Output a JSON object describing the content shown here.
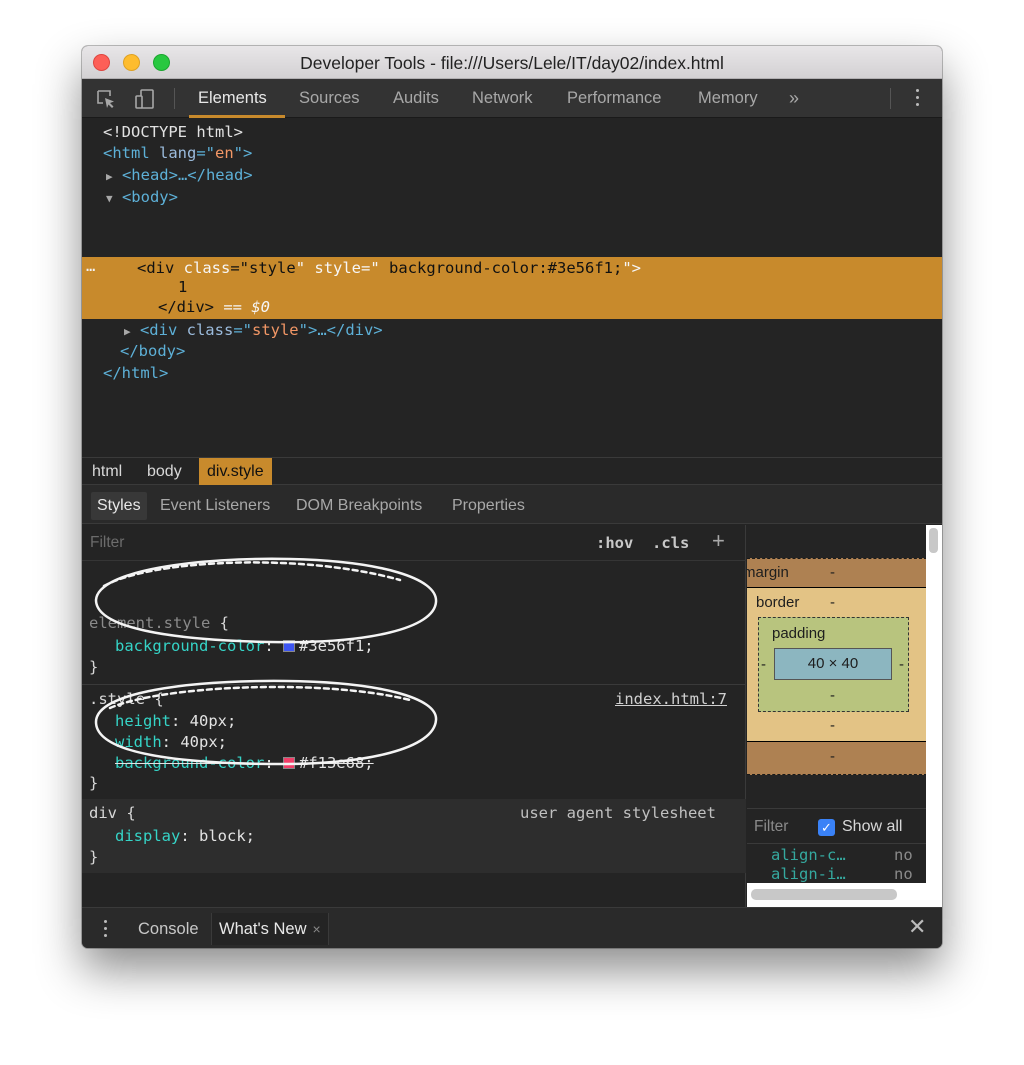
{
  "window": {
    "title": "Developer Tools - file:///Users/Lele/IT/day02/index.html"
  },
  "toolbar": {
    "tabs": [
      "Elements",
      "Sources",
      "Audits",
      "Network",
      "Performance",
      "Memory"
    ],
    "active_tab": "Elements",
    "overflow": "»",
    "icons": [
      "inspect-element-icon",
      "device-toolbar-icon",
      "more-menu-icon"
    ]
  },
  "dom": {
    "doctype": "<!DOCTYPE html>",
    "html_open_tag": "<html ",
    "html_attr_name": "lang",
    "html_attr_eq": "=\"",
    "html_attr_value": "en",
    "html_open_close": "\">",
    "head_collapsed": "<head>…</head>",
    "body_open": "<body>",
    "selected_dots": "…",
    "div_open_start": "<div ",
    "div_class_name": "class",
    "div_class_eq": "=\"",
    "div_class_value": "style",
    "div_class_close": "\" ",
    "div_style_name": "style",
    "div_style_eq": "=\"",
    "div_style_value": " background-color:#3e56f1;",
    "div_style_close": "\">",
    "div_text": "1",
    "div_close": "</div>",
    "dollar_zero": " == $0",
    "div2_open": "<div ",
    "div2_class_name": "class",
    "div2_class_eq": "=\"",
    "div2_class_value": "style",
    "div2_rest": "\">…</div>",
    "body_close": "</body>",
    "html_close": "</html>",
    "triangle_collapsed": "▶",
    "triangle_expanded": "▼"
  },
  "breadcrumb": [
    "html",
    "body",
    "div.style"
  ],
  "subtabs": [
    "Styles",
    "Event Listeners",
    "DOM Breakpoints",
    "Properties"
  ],
  "styles": {
    "filter_placeholder": "Filter",
    "hov": ":hov",
    "cls": ".cls",
    "plus": "+",
    "element_style": {
      "selector": "element.style",
      "open_brace": " {",
      "prop": "background-color",
      "value": "#3e56f1;",
      "swatch": "#3e56f1",
      "close_brace": "}"
    },
    "style_rule": {
      "selector": ".style",
      "open_brace": " {",
      "source": "index.html:7",
      "props": [
        {
          "name": "height",
          "value": "40px;"
        },
        {
          "name": "width",
          "value": "40px;"
        },
        {
          "name": "background-color",
          "value": "#f13e68;",
          "swatch": "#f13e68",
          "overridden": true
        }
      ],
      "close_brace": "}"
    },
    "div_rule": {
      "selector": "div",
      "open_brace": " {",
      "source": "user agent stylesheet",
      "prop": "display",
      "value": "block;",
      "close_brace": "}"
    }
  },
  "box_model": {
    "margin_label": "margin",
    "margin_value": "-",
    "border_label": "border",
    "border_value": "-",
    "padding_label": "padding",
    "padding_value": "-",
    "content": "40 × 40",
    "side_dash": "-"
  },
  "computed": {
    "filter_placeholder": "Filter",
    "show_all_label": "Show all",
    "show_all_checked": true,
    "rows": [
      {
        "name": "align-c…",
        "value": "no"
      },
      {
        "name": "align-i…",
        "value": "no"
      }
    ]
  },
  "drawer": {
    "tabs": [
      "Console",
      "What's New"
    ],
    "active_tab": "What's New",
    "tab_close": "×",
    "close": "✕"
  },
  "colors": {
    "accent": "#c88a2c",
    "element_bg": "#3e56f1",
    "overridden_bg": "#f13e68"
  }
}
